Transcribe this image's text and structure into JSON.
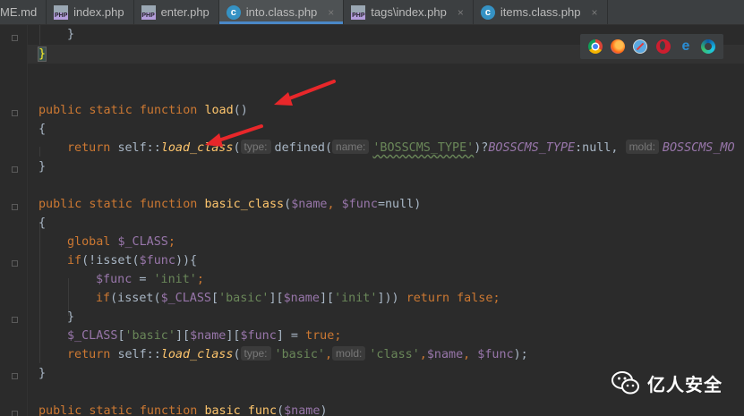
{
  "tabs": [
    {
      "label": "ME.md",
      "icon": "markdown-file-icon",
      "active": false
    },
    {
      "label": "index.php",
      "icon": "php-file-icon",
      "active": false
    },
    {
      "label": "enter.php",
      "icon": "php-file-icon",
      "active": false
    },
    {
      "label": "into.class.php",
      "icon": "php-class-icon",
      "active": true
    },
    {
      "label": "tags\\index.php",
      "icon": "php-file-icon",
      "active": false
    },
    {
      "label": "items.class.php",
      "icon": "php-class-icon",
      "active": false
    }
  ],
  "tab_close_glyph": "×",
  "php_icon_text": "PHP",
  "class_icon_text": "c",
  "browser_icons": [
    "chrome-icon",
    "firefox-icon",
    "safari-icon",
    "opera-icon",
    "internet-explorer-icon",
    "edge-icon"
  ],
  "code": {
    "l1": {
      "brace": "}"
    },
    "l2": {
      "brace": "}"
    },
    "l3": {
      "kw": "public static function",
      "name": "load",
      "rest": "()"
    },
    "l4": {
      "brace": "{"
    },
    "l5": {
      "kw": "return",
      "self": "self::",
      "call": "load_class",
      "open": "(",
      "hint_type": "type:",
      "fn": "defined(",
      "hint_name": "name:",
      "str": "'BOSSCMS_TYPE'",
      "mid": ")?",
      "const1": "BOSSCMS_TYPE",
      "colon_null": ":null, ",
      "hint_mold": "mold:",
      "const2": "BOSSCMS_MO"
    },
    "l6": {
      "brace": "}"
    },
    "l7": {
      "kw": "public static function",
      "name": "basic_class",
      "open": "(",
      "v1": "$name",
      "comma": ", ",
      "v2": "$func",
      "eq": "=null)"
    },
    "l8": {
      "brace": "{"
    },
    "l9": {
      "kw": "global",
      "var": "$_CLASS",
      "end": ";"
    },
    "l10": {
      "kw": "if",
      "a": "(!isset(",
      "var": "$func",
      "b": ")){"
    },
    "l11": {
      "var": "$func",
      "eq": " = ",
      "str": "'init'",
      "end": ";"
    },
    "l12": {
      "kw": "if",
      "a": "(isset(",
      "var": "$_CLASS",
      "b": "[",
      "s1": "'basic'",
      "c": "][",
      "v2": "$name",
      "d": "][",
      "s2": "'init'",
      "e": "])) ",
      "kw2": "return false",
      "end": ";"
    },
    "l13": {
      "brace": "}"
    },
    "l14": {
      "var": "$_CLASS",
      "a": "[",
      "s1": "'basic'",
      "b": "][",
      "v2": "$name",
      "c": "][",
      "v3": "$func",
      "d": "] = ",
      "kw": "true",
      "end": ";"
    },
    "l15": {
      "kw": "return",
      "self": "self::",
      "call": "load_class",
      "open": "(",
      "hint_type": "type:",
      "s1": "'basic'",
      "comma": ",",
      "hint_mold": "mold:",
      "s2": "'class'",
      "comma2": ",",
      "v1": "$name",
      "comma3": ", ",
      "v2": "$func",
      "end": ");"
    },
    "l16": {
      "brace": "}"
    },
    "l17": {
      "kw": "public static function",
      "name": "basic_func",
      "open": "(",
      "var": "$name",
      "close": ")"
    }
  },
  "watermark": {
    "text": "亿人安全"
  },
  "colors": {
    "background": "#2b2b2b",
    "keyword": "#cc7832",
    "function": "#ffc66d",
    "variable": "#9876aa",
    "string": "#6a8759",
    "active_tab_underline": "#4a88c7",
    "arrow": "#e8272a"
  }
}
